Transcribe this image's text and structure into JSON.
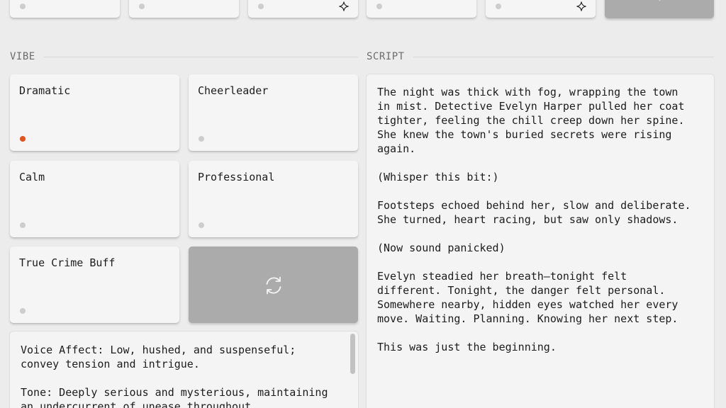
{
  "voices_row": [
    {
      "id": "voice-1",
      "has_sparkle": false
    },
    {
      "id": "voice-2",
      "has_sparkle": false
    },
    {
      "id": "voice-3",
      "has_sparkle": true
    },
    {
      "id": "voice-4",
      "has_sparkle": false
    },
    {
      "id": "voice-5",
      "has_sparkle": true
    }
  ],
  "vibe": {
    "section_label": "VIBE",
    "options": [
      {
        "label": "Dramatic",
        "selected": true
      },
      {
        "label": "Cheerleader",
        "selected": false
      },
      {
        "label": "Calm",
        "selected": false
      },
      {
        "label": "Professional",
        "selected": false
      },
      {
        "label": "True Crime Buff",
        "selected": false
      }
    ],
    "shuffle_icon": "refresh-icon",
    "instructions": "Voice Affect: Low, hushed, and suspenseful; convey tension and intrigue.\n\nTone: Deeply serious and mysterious, maintaining an undercurrent of unease throughout."
  },
  "script": {
    "section_label": "SCRIPT",
    "text": "The night was thick with fog, wrapping the town\nin mist. Detective Evelyn Harper pulled her coat\ntighter, feeling the chill creep down her spine.\nShe knew the town's buried secrets were rising\nagain.\n\n(Whisper this bit:)\n\nFootsteps echoed behind her, slow and deliberate.\nShe turned, heart racing, but saw only shadows.\n\n(Now sound panicked)\n\nEvelyn steadied her breath—tonight felt\ndifferent. Tonight, the danger felt personal.\nSomewhere nearby, hidden eyes watched her every\nmove. Waiting. Planning. Knowing her next step.\n\nThis was just the beginning."
  },
  "colors": {
    "background": "#ececec",
    "card": "#f5f5f5",
    "selected_dot": "#e5531a",
    "idle_dot": "#cdcdcd",
    "gray_button": "#ababab"
  }
}
